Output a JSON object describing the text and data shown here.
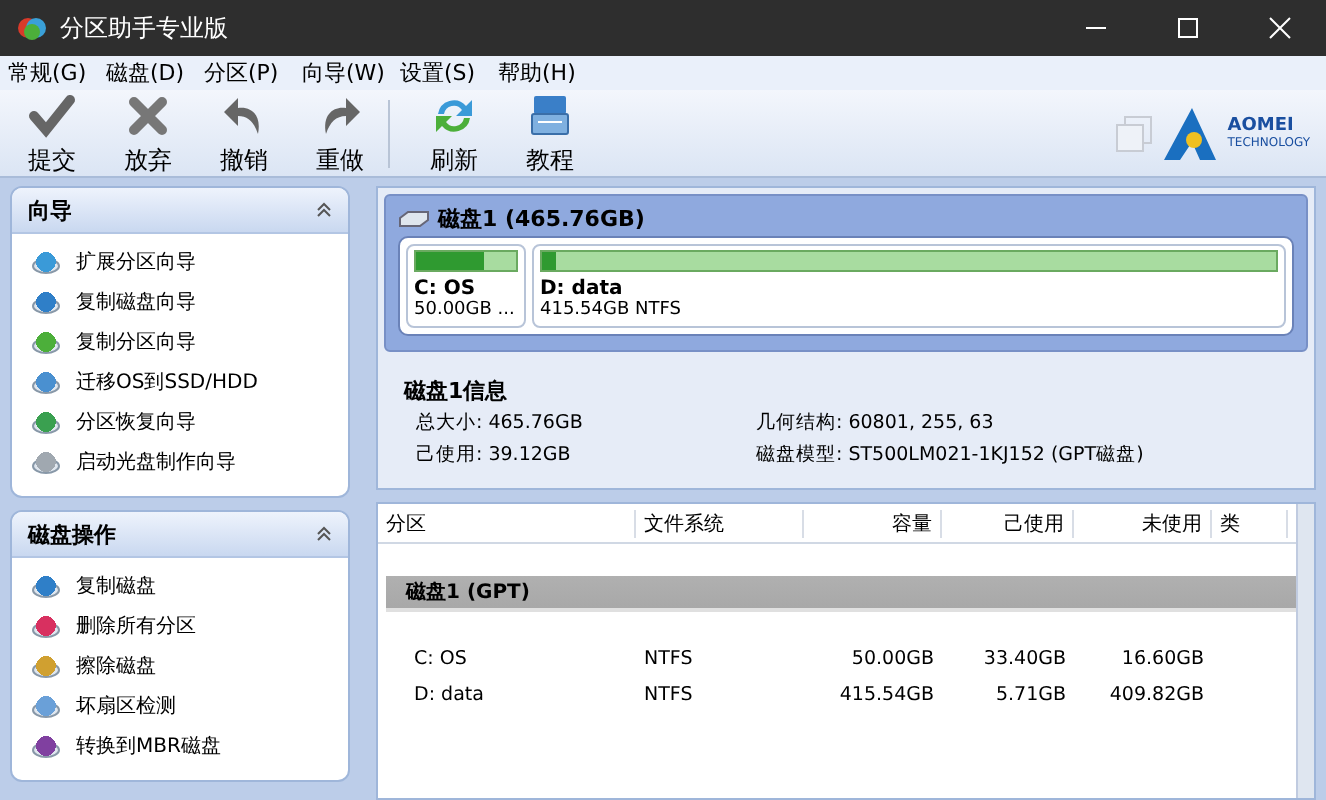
{
  "window": {
    "title": "分区助手专业版"
  },
  "menu": [
    "常规(G)",
    "磁盘(D)",
    "分区(P)",
    "向导(W)",
    "设置(S)",
    "帮助(H)"
  ],
  "toolbar_groups": [
    [
      {
        "label": "提交",
        "kind": "check"
      },
      {
        "label": "放弃",
        "kind": "cross"
      },
      {
        "label": "撤销",
        "kind": "undo"
      },
      {
        "label": "重做",
        "kind": "redo"
      }
    ],
    [
      {
        "label": "刷新",
        "kind": "refresh"
      },
      {
        "label": "教程",
        "kind": "book"
      }
    ]
  ],
  "logo": {
    "name": "AOMEI",
    "subtitle": "TECHNOLOGY"
  },
  "sidebar": [
    {
      "title": "向导",
      "expanded": true,
      "items": [
        {
          "label": "扩展分区向导",
          "color": "#3a9ad8"
        },
        {
          "label": "复制磁盘向导",
          "color": "#2f7fc8"
        },
        {
          "label": "复制分区向导",
          "color": "#4caf3a"
        },
        {
          "label": "迁移OS到SSD/HDD",
          "color": "#4a90d0"
        },
        {
          "label": "分区恢复向导",
          "color": "#3aa050"
        },
        {
          "label": "启动光盘制作向导",
          "color": "#a0a8b0"
        }
      ]
    },
    {
      "title": "磁盘操作",
      "expanded": true,
      "items": [
        {
          "label": "复制磁盘",
          "color": "#2f7fc8"
        },
        {
          "label": "删除所有分区",
          "color": "#d83060"
        },
        {
          "label": "擦除磁盘",
          "color": "#d0a030"
        },
        {
          "label": "坏扇区检测",
          "color": "#6aa0d8"
        },
        {
          "label": "转换到MBR磁盘",
          "color": "#8040a0"
        }
      ]
    }
  ],
  "disk_map": {
    "title": "磁盘1 (465.76GB)",
    "partitions": [
      {
        "name": "C: OS",
        "detail": "50.00GB ...",
        "level": 0.67
      },
      {
        "name": "D: data",
        "detail": "415.54GB NTFS",
        "level": 0.02
      }
    ]
  },
  "disk_info": {
    "title": "磁盘1信息",
    "fields": [
      "总大小: 465.76GB",
      "几何结构: 60801, 255, 63",
      "己使用: 39.12GB",
      "磁盘模型: ST500LM021-1KJ152 (GPT磁盘)"
    ]
  },
  "table": {
    "columns": [
      "分区",
      "文件系统",
      "容量",
      "己使用",
      "未使用",
      "类"
    ],
    "groups": [
      {
        "title": "磁盘1 (GPT)",
        "rows": [
          [
            "C: OS",
            "NTFS",
            "50.00GB",
            "33.40GB",
            "16.60GB"
          ],
          [
            "D: data",
            "NTFS",
            "415.54GB",
            "5.71GB",
            "409.82GB"
          ]
        ]
      }
    ]
  }
}
